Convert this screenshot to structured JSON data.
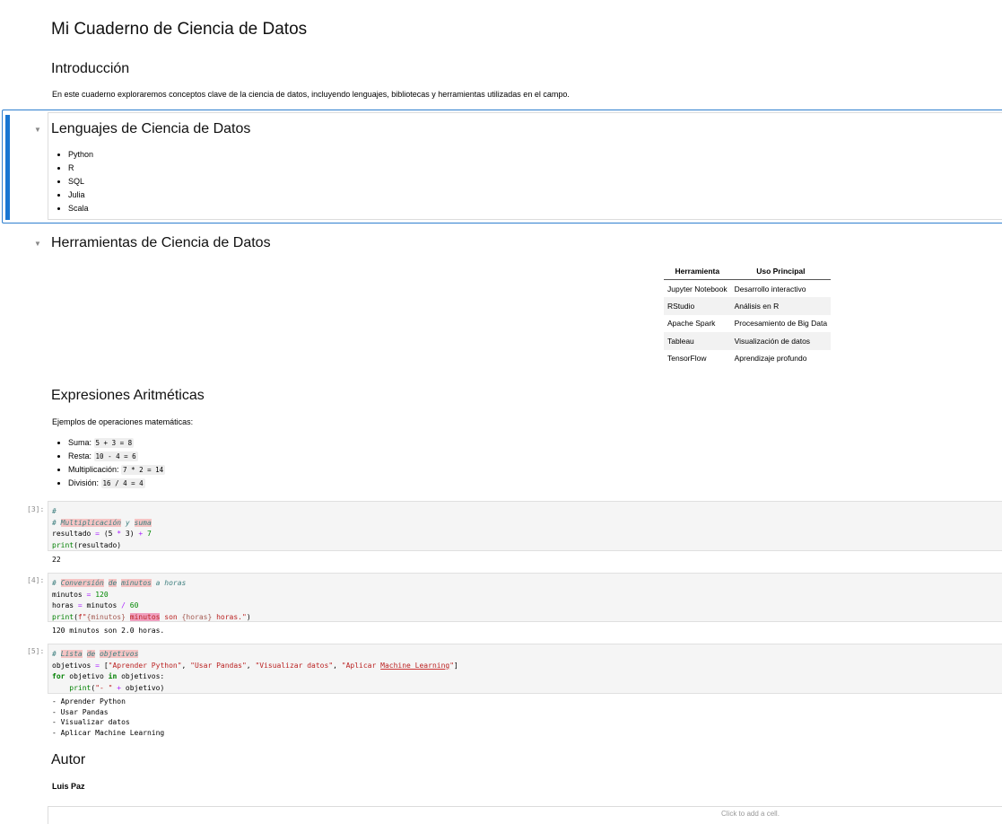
{
  "title": "Mi Cuaderno de Ciencia de Datos",
  "intro": {
    "heading": "Introducción",
    "text": "En este cuaderno exploraremos conceptos clave de la ciencia de datos, incluyendo lenguajes, bibliotecas y herramientas utilizadas en el campo."
  },
  "languages": {
    "heading": "Lenguajes de Ciencia de Datos",
    "items": [
      "Python",
      "R",
      "SQL",
      "Julia",
      "Scala"
    ]
  },
  "tools": {
    "heading": "Herramientas de Ciencia de Datos",
    "columns": [
      "Herramienta",
      "Uso Principal"
    ],
    "rows": [
      [
        "Jupyter Notebook",
        "Desarrollo interactivo"
      ],
      [
        "RStudio",
        "Análisis en R"
      ],
      [
        "Apache Spark",
        "Procesamiento de Big Data"
      ],
      [
        "Tableau",
        "Visualización de datos"
      ],
      [
        "TensorFlow",
        "Aprendizaje profundo"
      ]
    ]
  },
  "arith": {
    "heading": "Expresiones Aritméticas",
    "text": "Ejemplos de operaciones matemáticas:",
    "items": [
      {
        "label": "Suma:",
        "code": "5 + 3 = 8"
      },
      {
        "label": "Resta:",
        "code": "10 - 4 = 6"
      },
      {
        "label": "Multiplicación:",
        "code": "7 * 2 = 14"
      },
      {
        "label": "División:",
        "code": "16 / 4 = 4"
      }
    ]
  },
  "cells": [
    {
      "prompt": "[3]:",
      "lines": [
        [
          {
            "t": "#",
            "c": "c-cm"
          }
        ],
        [
          {
            "t": "# ",
            "c": "c-cm"
          },
          {
            "t": "Multiplicación",
            "c": "c-cm c-sp"
          },
          {
            "t": " y ",
            "c": "c-cm"
          },
          {
            "t": "suma",
            "c": "c-cm c-sp"
          }
        ],
        [
          {
            "t": "resultado "
          },
          {
            "t": "=",
            "c": "c-op"
          },
          {
            "t": " (5 "
          },
          {
            "t": "*",
            "c": "c-op"
          },
          {
            "t": " 3) "
          },
          {
            "t": "+",
            "c": "c-op"
          },
          {
            "t": " 7",
            "c": "c-num"
          }
        ],
        [
          {
            "t": "print",
            "c": "c-fn"
          },
          {
            "t": "(resultado)"
          }
        ]
      ],
      "output": "22"
    },
    {
      "prompt": "[4]:",
      "lines": [
        [
          {
            "t": "# ",
            "c": "c-cm"
          },
          {
            "t": "Conversión",
            "c": "c-cm c-sp"
          },
          {
            "t": " ",
            "c": "c-cm"
          },
          {
            "t": "de",
            "c": "c-cm c-sp"
          },
          {
            "t": " ",
            "c": "c-cm"
          },
          {
            "t": "minutos",
            "c": "c-cm c-sp"
          },
          {
            "t": " a horas",
            "c": "c-cm"
          }
        ],
        [
          {
            "t": "minutos "
          },
          {
            "t": "=",
            "c": "c-op"
          },
          {
            "t": " "
          },
          {
            "t": "120",
            "c": "c-num"
          }
        ],
        [
          {
            "t": "horas "
          },
          {
            "t": "=",
            "c": "c-op"
          },
          {
            "t": " minutos "
          },
          {
            "t": "/",
            "c": "c-op"
          },
          {
            "t": " "
          },
          {
            "t": "60",
            "c": "c-num"
          }
        ],
        [
          {
            "t": "print",
            "c": "c-fn"
          },
          {
            "t": "("
          },
          {
            "t": "f\"",
            "c": "c-str"
          },
          {
            "t": "{minutos}",
            "c": "c-ph"
          },
          {
            "t": " ",
            "c": "c-str"
          },
          {
            "t": "minutos",
            "c": "c-str c-sp2"
          },
          {
            "t": " son ",
            "c": "c-str"
          },
          {
            "t": "{horas}",
            "c": "c-ph"
          },
          {
            "t": " horas.\"",
            "c": "c-str"
          },
          {
            "t": ")"
          }
        ]
      ],
      "output": "120 minutos son 2.0 horas."
    },
    {
      "prompt": "[5]:",
      "lines": [
        [
          {
            "t": "# ",
            "c": "c-cm"
          },
          {
            "t": "Lista",
            "c": "c-cm c-sp"
          },
          {
            "t": " ",
            "c": "c-cm"
          },
          {
            "t": "de",
            "c": "c-cm c-sp"
          },
          {
            "t": " ",
            "c": "c-cm"
          },
          {
            "t": "objetivos",
            "c": "c-cm c-sp"
          }
        ],
        [
          {
            "t": "objetivos "
          },
          {
            "t": "=",
            "c": "c-op"
          },
          {
            "t": " ["
          },
          {
            "t": "\"Aprender Python\"",
            "c": "c-str"
          },
          {
            "t": ", "
          },
          {
            "t": "\"Usar Pandas\"",
            "c": "c-str"
          },
          {
            "t": ", "
          },
          {
            "t": "\"Visualizar datos\"",
            "c": "c-str"
          },
          {
            "t": ", "
          },
          {
            "t": "\"Aplicar ",
            "c": "c-str"
          },
          {
            "t": "Machine Learning",
            "c": "c-str c-ul"
          },
          {
            "t": "\"",
            "c": "c-str"
          },
          {
            "t": "]"
          }
        ],
        [
          {
            "t": "for",
            "c": "c-kw"
          },
          {
            "t": " objetivo "
          },
          {
            "t": "in",
            "c": "c-kw"
          },
          {
            "t": " objetivos:"
          }
        ],
        [
          {
            "t": "    "
          },
          {
            "t": "print",
            "c": "c-fn"
          },
          {
            "t": "("
          },
          {
            "t": "\"- \"",
            "c": "c-str"
          },
          {
            "t": " "
          },
          {
            "t": "+",
            "c": "c-op"
          },
          {
            "t": " objetivo)"
          }
        ]
      ],
      "output": "- Aprender Python\n- Usar Pandas\n- Visualizar datos\n- Aplicar Machine Learning"
    }
  ],
  "author": {
    "heading": "Autor",
    "name": "Luis Paz"
  },
  "add_cell_hint": "Click to add a cell."
}
